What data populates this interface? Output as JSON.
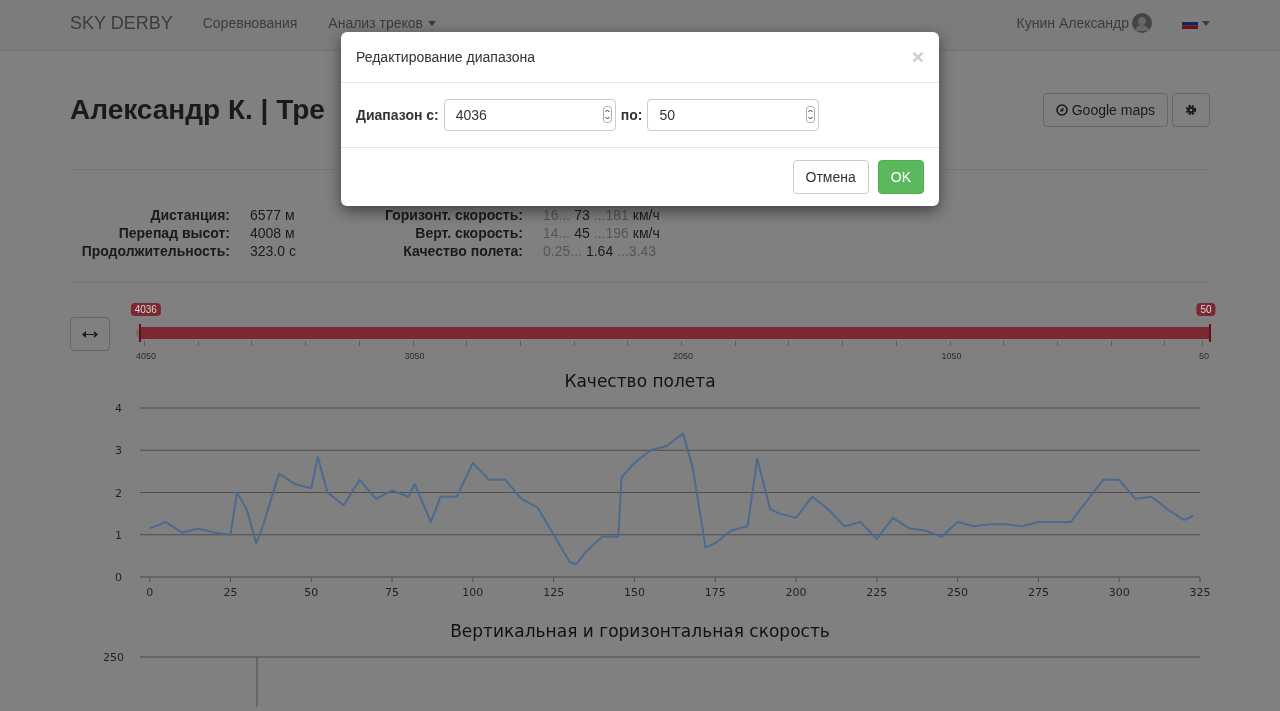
{
  "navbar": {
    "brand": "SKY DERBY",
    "links": [
      {
        "label": "Соревнования",
        "dropdown": false
      },
      {
        "label": "Анализ треков",
        "dropdown": true
      }
    ],
    "user": "Кунин Александр"
  },
  "page": {
    "title": "Александр К. | Тре",
    "buttons": [
      {
        "kind": "maps",
        "label": "Google maps"
      },
      {
        "kind": "settings"
      }
    ]
  },
  "stats_left": [
    {
      "label": "Дистанция:",
      "value": "6577 м"
    },
    {
      "label": "Перепад высот:",
      "value": "4008 м"
    },
    {
      "label": "Продолжительность:",
      "value": "323.0 с"
    }
  ],
  "stats_right": [
    {
      "label": "Горизонт. скорость:",
      "min": "16...",
      "value": "73",
      "max": "...181",
      "unit": "км/ч"
    },
    {
      "label": "Верт. скорость:",
      "min": "14...",
      "value": "45",
      "max": "...196",
      "unit": "км/ч"
    },
    {
      "label": "Качество полета:",
      "min": "0.25...",
      "value": "1.64",
      "max": "...3.43"
    }
  ],
  "range_slider": {
    "handles": [
      {
        "label": "4036",
        "level": 0.0035
      },
      {
        "label": "50",
        "level": 1
      }
    ],
    "ticks": [
      "4050",
      "3050",
      "2050",
      "1050",
      "50"
    ]
  },
  "quality_chart": {
    "chart_data": {
      "type": "line",
      "title": "Качество полета",
      "x": [
        0,
        5,
        10,
        15,
        20,
        25,
        27,
        30,
        33,
        35,
        40,
        45,
        50,
        52,
        55,
        60,
        65,
        70,
        75,
        80,
        82,
        87,
        90,
        95,
        100,
        105,
        110,
        115,
        120,
        125,
        130,
        132,
        135,
        140,
        145,
        146,
        150,
        155,
        160,
        165,
        168,
        172,
        175,
        180,
        185,
        188,
        192,
        195,
        200,
        205,
        210,
        215,
        220,
        225,
        230,
        235,
        240,
        245,
        250,
        255,
        260,
        265,
        270,
        275,
        280,
        285,
        290,
        295,
        300,
        305,
        310,
        315,
        320,
        323
      ],
      "series": [
        {
          "color": "#4a6b8f",
          "values": [
            1.15,
            1.3,
            1.05,
            1.15,
            1.05,
            1.0,
            2.0,
            1.6,
            0.8,
            1.2,
            2.45,
            2.2,
            2.1,
            2.85,
            2.0,
            1.7,
            2.3,
            1.85,
            2.05,
            1.9,
            2.2,
            1.3,
            1.9,
            1.9,
            2.7,
            2.3,
            2.3,
            1.85,
            1.65,
            1.0,
            0.35,
            0.3,
            0.6,
            0.95,
            0.95,
            2.35,
            2.7,
            3.0,
            3.1,
            3.4,
            2.6,
            0.7,
            0.8,
            1.1,
            1.2,
            2.8,
            1.6,
            1.5,
            1.4,
            1.9,
            1.6,
            1.2,
            1.3,
            0.9,
            1.4,
            1.15,
            1.1,
            0.95,
            1.3,
            1.2,
            1.25,
            1.25,
            1.2,
            1.3,
            1.3,
            1.3,
            1.8,
            2.3,
            2.3,
            1.85,
            1.9,
            1.6,
            1.35,
            1.45
          ]
        }
      ],
      "grid": true,
      "xlim": [
        -3,
        325
      ],
      "ylim": [
        0,
        4
      ],
      "xticks": [
        0,
        25,
        50,
        75,
        100,
        125,
        150,
        175,
        200,
        225,
        250,
        275,
        300,
        325
      ],
      "yticks": [
        0,
        1,
        2,
        3,
        4
      ]
    }
  },
  "speed_chart": {
    "title": "Вертикальная и горизонтальная скорость",
    "y_tick": "250"
  },
  "modal": {
    "title": "Редактирование диапазона",
    "close": "×",
    "from_label": "Диапазон с:",
    "from_value": "4036",
    "to_label": "по:",
    "to_value": "50",
    "buttons": [
      {
        "kind": "default",
        "label": "Отмена"
      },
      {
        "kind": "success",
        "label": "OK"
      }
    ]
  }
}
